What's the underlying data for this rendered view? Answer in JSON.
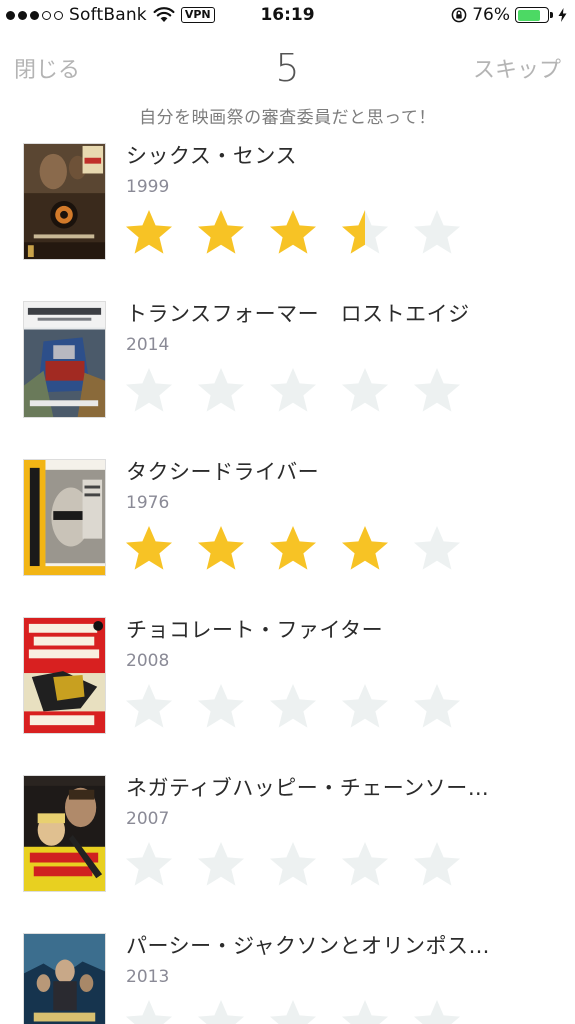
{
  "status_bar": {
    "carrier": "SoftBank",
    "vpn": "VPN",
    "time": "16:19",
    "battery_percent": "76%",
    "battery_level": 0.76,
    "signal_filled": 3,
    "signal_total": 5
  },
  "nav": {
    "close_label": "閉じる",
    "count": "5",
    "skip_label": "スキップ"
  },
  "subtitle": "自分を映画祭の審査委員だと思って！",
  "colors": {
    "star_filled": "#f7c325",
    "star_empty": "#edf1f1",
    "battery_fill": "#4cd964"
  },
  "movies": [
    {
      "title": "シックス・センス",
      "year": "1999",
      "rating": 3.5
    },
    {
      "title": "トランスフォーマー　ロストエイジ",
      "year": "2014",
      "rating": 0
    },
    {
      "title": "タクシードライバー",
      "year": "1976",
      "rating": 4
    },
    {
      "title": "チョコレート・ファイター",
      "year": "2008",
      "rating": 0
    },
    {
      "title": "ネガティブハッピー・チェーンソー…",
      "year": "2007",
      "rating": 0
    },
    {
      "title": "パーシー・ジャクソンとオリンポス…",
      "year": "2013",
      "rating": 0
    }
  ]
}
